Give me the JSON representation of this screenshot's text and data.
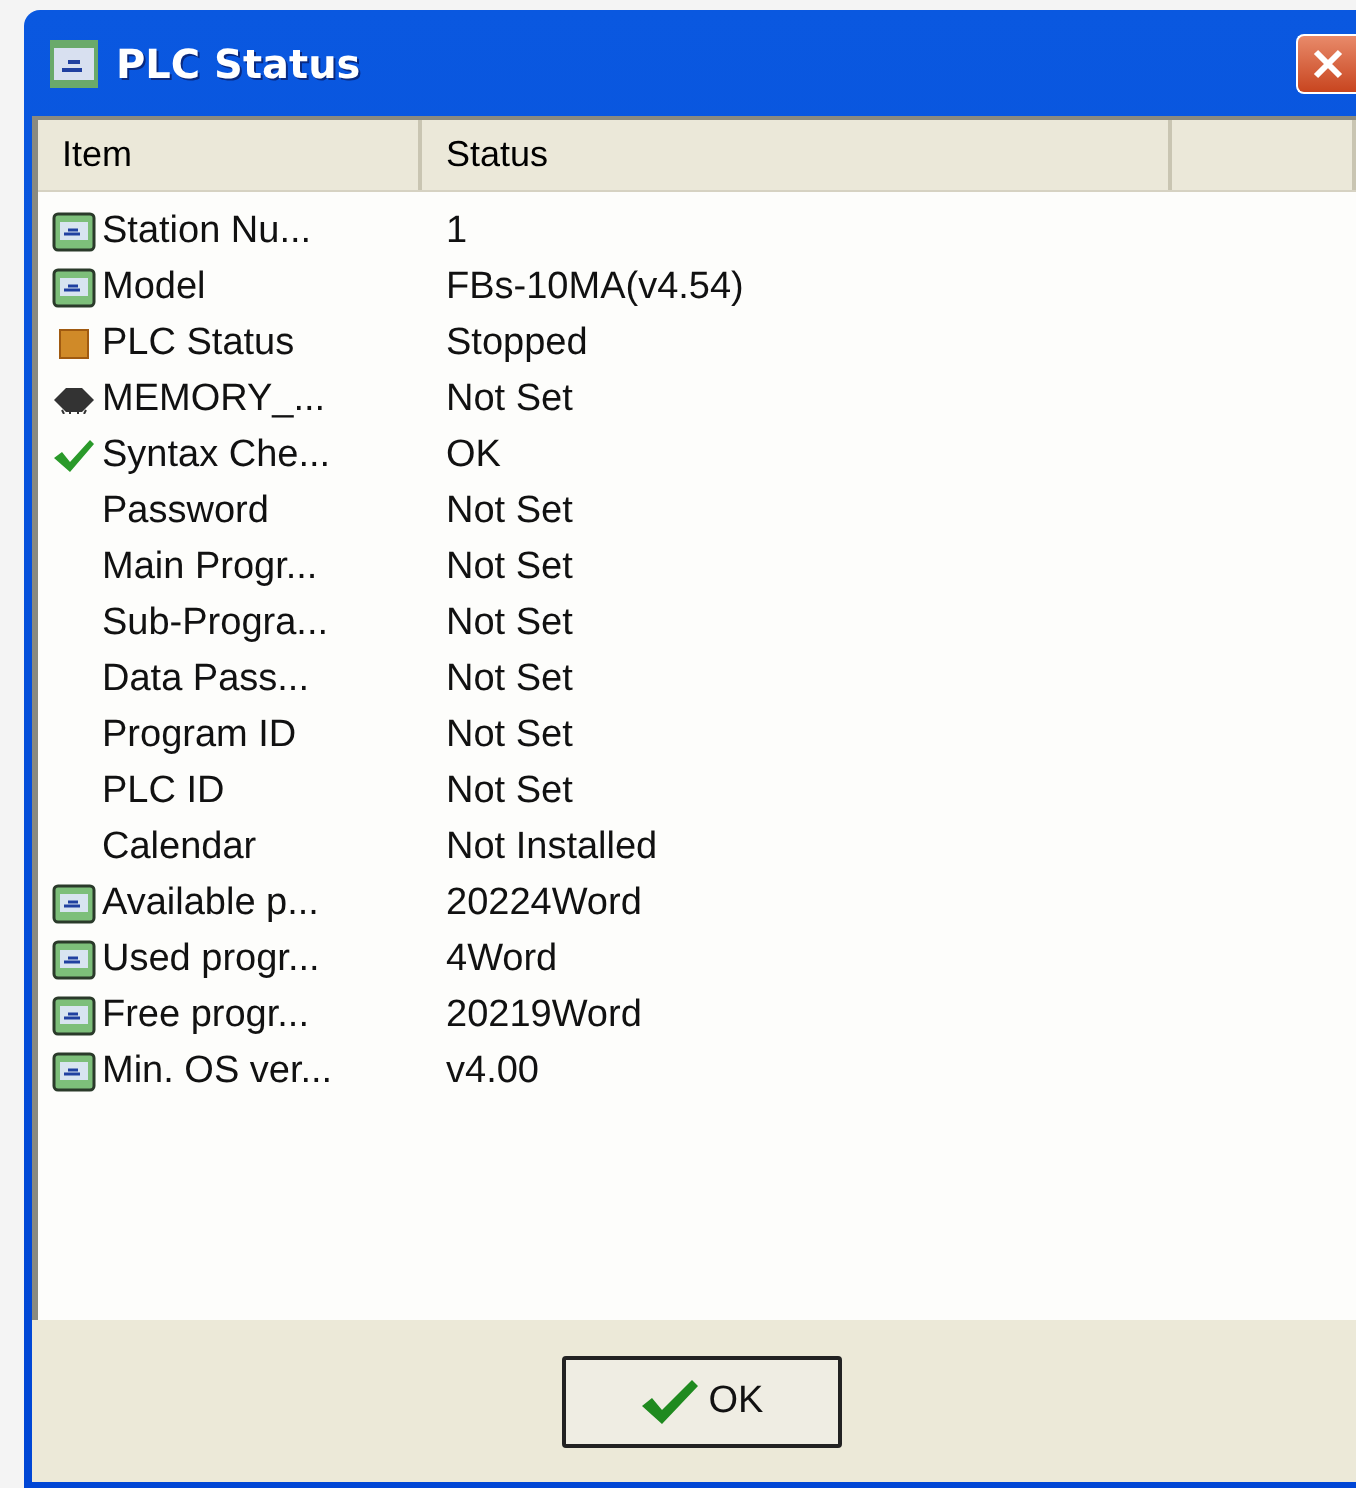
{
  "window": {
    "title": "PLC Status"
  },
  "table": {
    "columns": [
      "Item",
      "Status"
    ],
    "rows": [
      {
        "kind": "module",
        "item": "Station Nu...",
        "status": "1"
      },
      {
        "kind": "module",
        "item": "Model",
        "status": "FBs-10MA(v4.54)"
      },
      {
        "kind": "stop",
        "item": "PLC Status",
        "status": "Stopped"
      },
      {
        "kind": "chip",
        "item": "MEMORY_...",
        "status": "Not Set"
      },
      {
        "kind": "check",
        "item": "Syntax Che...",
        "status": "OK"
      },
      {
        "kind": "none",
        "item": "Password",
        "status": "Not Set"
      },
      {
        "kind": "none",
        "item": "Main Progr...",
        "status": "Not Set"
      },
      {
        "kind": "none",
        "item": "Sub-Progra...",
        "status": "Not Set"
      },
      {
        "kind": "none",
        "item": "Data Pass...",
        "status": "Not Set"
      },
      {
        "kind": "none",
        "item": "Program ID",
        "status": "Not Set"
      },
      {
        "kind": "none",
        "item": "PLC ID",
        "status": "Not Set"
      },
      {
        "kind": "none",
        "item": "Calendar",
        "status": "Not Installed"
      },
      {
        "kind": "module",
        "item": "Available p...",
        "status": "20224Word"
      },
      {
        "kind": "module",
        "item": "Used progr...",
        "status": "4Word"
      },
      {
        "kind": "module",
        "item": "Free progr...",
        "status": "20219Word"
      },
      {
        "kind": "module",
        "item": "Min. OS ver...",
        "status": "v4.00"
      }
    ]
  },
  "buttons": [
    {
      "label": "OK"
    }
  ]
}
